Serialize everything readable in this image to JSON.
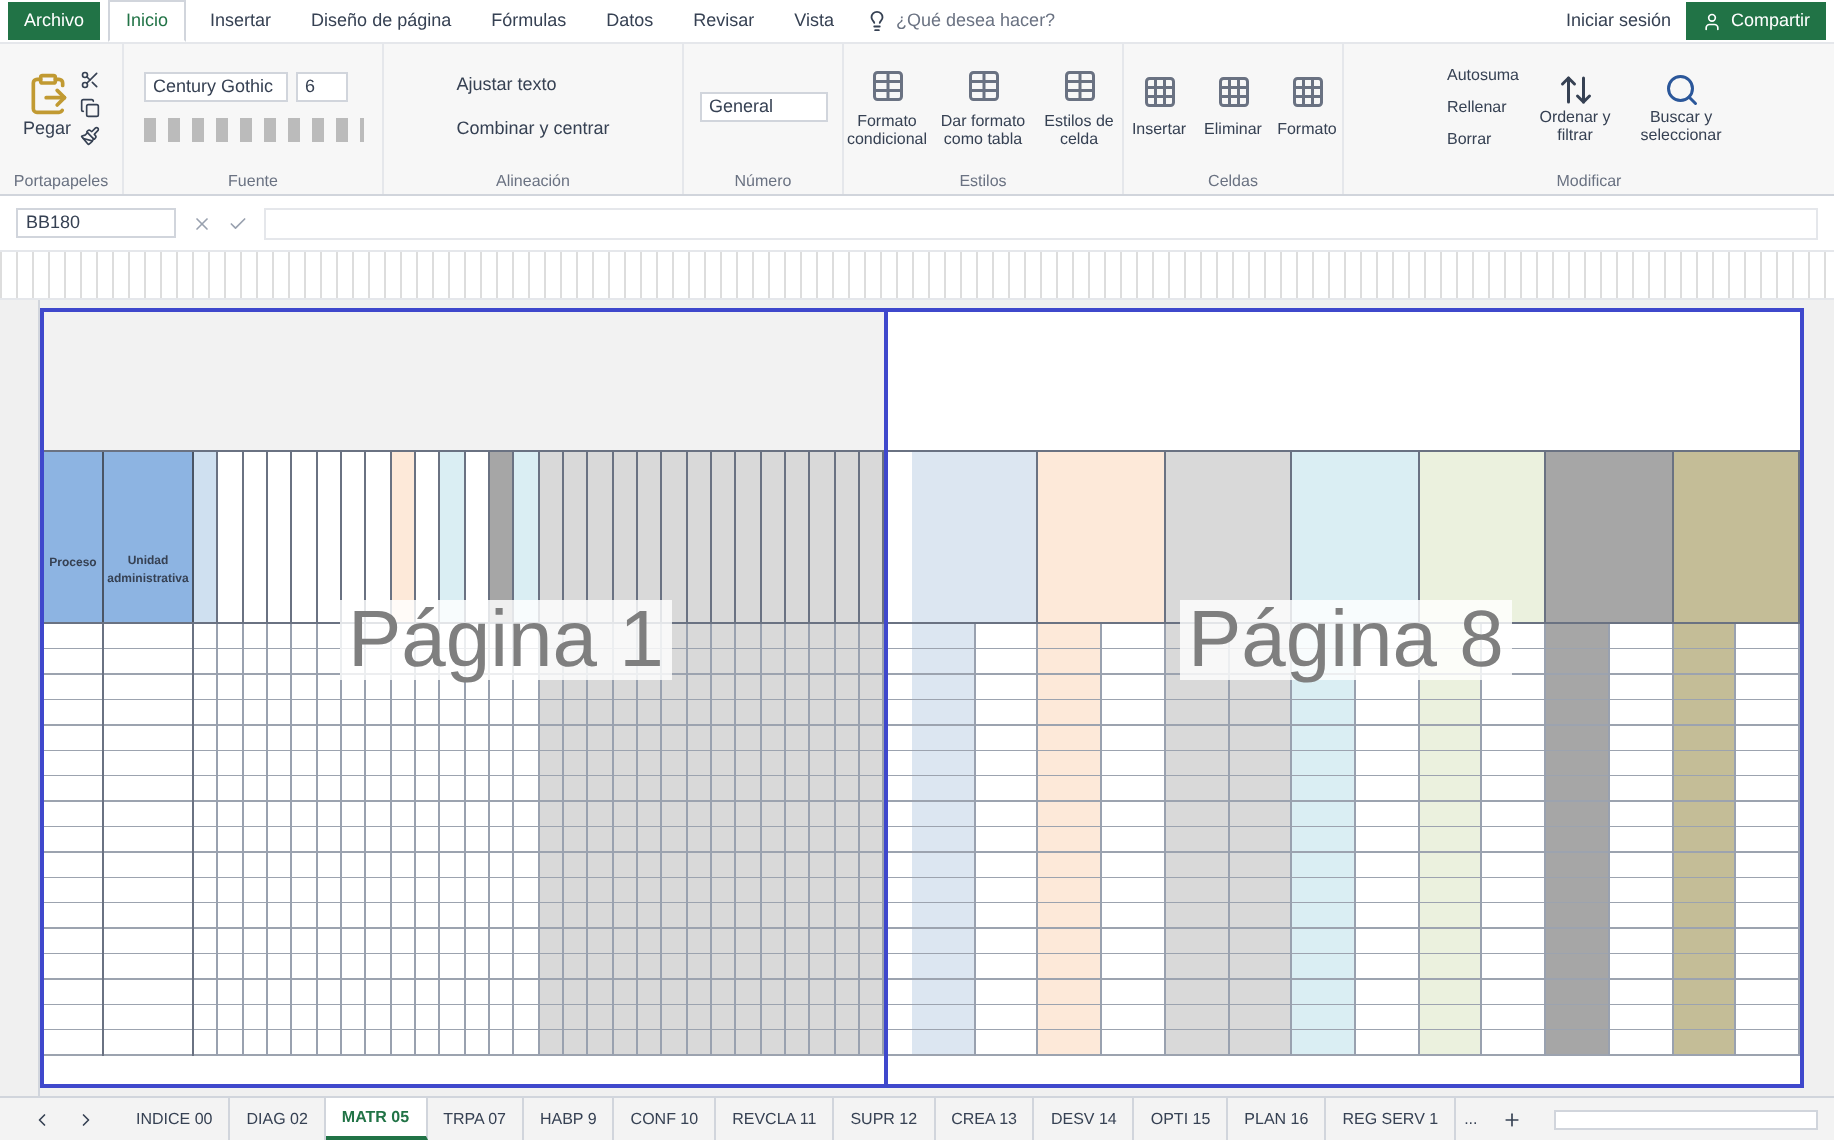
{
  "ribbon_tabs": [
    {
      "label": "Archivo",
      "kind": "file",
      "selected": false
    },
    {
      "label": "Inicio",
      "kind": "tab",
      "selected": true
    },
    {
      "label": "Insertar",
      "kind": "tab",
      "selected": false
    },
    {
      "label": "Diseño de página",
      "kind": "tab",
      "selected": false
    },
    {
      "label": "Fórmulas",
      "kind": "tab",
      "selected": false
    },
    {
      "label": "Datos",
      "kind": "tab",
      "selected": false
    },
    {
      "label": "Revisar",
      "kind": "tab",
      "selected": false
    },
    {
      "label": "Vista",
      "kind": "tab",
      "selected": false
    }
  ],
  "tell_me": "¿Qué desea hacer?",
  "sign_in": "Iniciar sesión",
  "share": "Compartir",
  "clipboard": {
    "paste": "Pegar",
    "label": "Portapapeles"
  },
  "font": {
    "name": "Century Gothic",
    "size": "6",
    "label": "Fuente"
  },
  "alignment": {
    "wrap": "Ajustar texto",
    "merge": "Combinar y centrar",
    "label": "Alineación"
  },
  "number": {
    "format": "General",
    "label": "Número"
  },
  "styles": {
    "buttons": [
      "Formato condicional",
      "Dar formato como tabla",
      "Estilos de celda"
    ],
    "label": "Estilos"
  },
  "cells": {
    "buttons": [
      "Insertar",
      "Eliminar",
      "Formato"
    ],
    "label": "Celdas"
  },
  "editing": {
    "items": [
      "Autosuma",
      "Rellenar",
      "Borrar"
    ],
    "sort": "Ordenar y filtrar",
    "find": "Buscar y seleccionar",
    "label": "Modificar"
  },
  "name_box": "BB180",
  "sheet": {
    "header_left": [
      "Proceso",
      "Unidad administrativa"
    ],
    "page_labels": [
      "Página 1",
      "Página 8"
    ]
  },
  "sheet_tabs": [
    {
      "label": "INDICE 00",
      "selected": false
    },
    {
      "label": "DIAG 02",
      "selected": false
    },
    {
      "label": "MATR 05",
      "selected": true
    },
    {
      "label": "TRPA 07",
      "selected": false
    },
    {
      "label": "HABP 9",
      "selected": false
    },
    {
      "label": "CONF 10",
      "selected": false
    },
    {
      "label": "REVCLA 11",
      "selected": false
    },
    {
      "label": "SUPR 12",
      "selected": false
    },
    {
      "label": "CREA 13",
      "selected": false
    },
    {
      "label": "DESV 14",
      "selected": false
    },
    {
      "label": "OPTI 15",
      "selected": false
    },
    {
      "label": "PLAN 16",
      "selected": false
    },
    {
      "label": "REG SERV 1",
      "selected": false
    }
  ],
  "more_tabs": "..."
}
